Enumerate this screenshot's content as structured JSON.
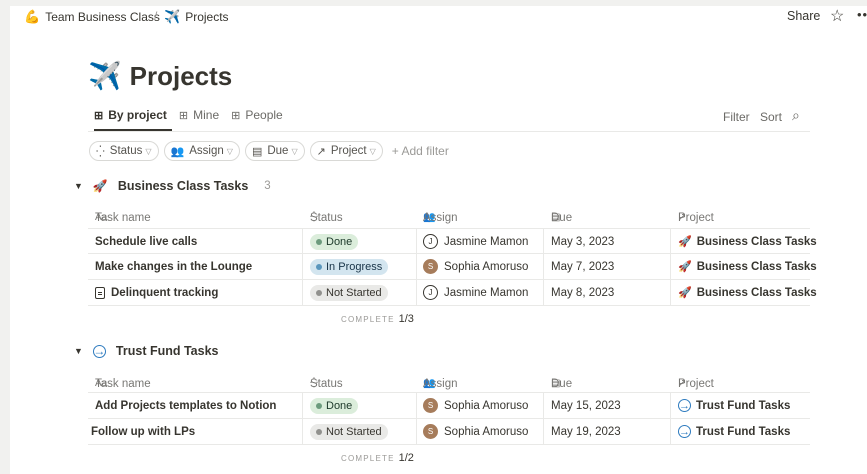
{
  "breadcrumb": {
    "workspace": {
      "emoji": "💪",
      "label": "Team Business Class"
    },
    "separator": "/",
    "page": {
      "emoji": "✈️",
      "label": "Projects"
    }
  },
  "topbar": {
    "share": "Share",
    "favorite_icon": "☆",
    "more_icon": "•••"
  },
  "page": {
    "emoji": "✈️",
    "title": "Projects"
  },
  "views": [
    {
      "icon": "table-icon",
      "label": "By project",
      "active": true
    },
    {
      "icon": "table-icon",
      "label": "Mine",
      "active": false
    },
    {
      "icon": "table-icon",
      "label": "People",
      "active": false
    }
  ],
  "toolbar": {
    "filter": "Filter",
    "sort": "Sort",
    "search_icon": "search-icon"
  },
  "filters": {
    "status": "Status",
    "assign": "Assign",
    "due": "Due",
    "project": "Project",
    "add_filter": "+ Add filter"
  },
  "columns": {
    "task": "Task name",
    "task_prefix": "Aa",
    "status": "Status",
    "assign": "Assign",
    "due": "Due",
    "project": "Project"
  },
  "groups": [
    {
      "name": "Business Class Tasks",
      "count": "3",
      "complete_label": "COMPLETE",
      "complete_value": "1/3",
      "rows": [
        {
          "task": "Schedule live calls",
          "status": "Done",
          "assign": "Jasmine Mamon",
          "due": "May 3, 2023",
          "project": "Business Class Tasks"
        },
        {
          "task": "Make changes in the Lounge",
          "status": "In Progress",
          "assign": "Sophia Amoruso",
          "due": "May 7, 2023",
          "project": "Business Class Tasks"
        },
        {
          "task": "Delinquent tracking",
          "status": "Not Started",
          "assign": "Jasmine Mamon",
          "due": "May 8, 2023",
          "project": "Business Class Tasks"
        }
      ]
    },
    {
      "name": "Trust Fund Tasks",
      "count": "",
      "complete_label": "COMPLETE",
      "complete_value": "1/2",
      "rows": [
        {
          "task": "Add Projects templates to Notion",
          "status": "Done",
          "assign": "Sophia Amoruso",
          "due": "May 15, 2023",
          "project": "Trust Fund Tasks"
        },
        {
          "task": "Follow up with LPs",
          "status": "Not Started",
          "assign": "Sophia Amoruso",
          "due": "May 19, 2023",
          "project": "Trust Fund Tasks"
        }
      ]
    }
  ],
  "colors": {
    "accent": "#2e7bbf",
    "done": "#dbeddb",
    "in_progress": "#d3e5ef",
    "not_started": "#e9e9e7"
  }
}
